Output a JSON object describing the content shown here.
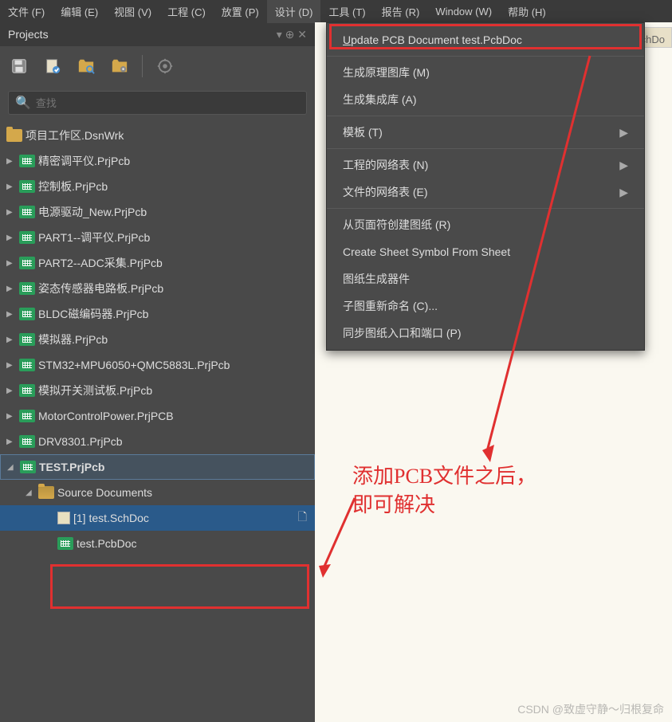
{
  "menubar": {
    "items": [
      {
        "label": "文件 (F)"
      },
      {
        "label": "编辑 (E)"
      },
      {
        "label": "视图 (V)"
      },
      {
        "label": "工程 (C)"
      },
      {
        "label": "放置 (P)"
      },
      {
        "label": "设计 (D)",
        "active": true
      },
      {
        "label": "工具 (T)"
      },
      {
        "label": "报告 (R)"
      },
      {
        "label": "Window (W)"
      },
      {
        "label": "帮助 (H)"
      }
    ]
  },
  "panel": {
    "title": "Projects",
    "pin": "▾ ⊕ ✕"
  },
  "search": {
    "placeholder": "查找"
  },
  "tree": {
    "workspace": "项目工作区.DsnWrk",
    "projects": [
      "精密调平仪.PrjPcb",
      "控制板.PrjPcb",
      "电源驱动_New.PrjPcb",
      "PART1--调平仪.PrjPcb",
      "PART2--ADC采集.PrjPcb",
      "姿态传感器电路板.PrjPcb",
      "BLDC磁编码器.PrjPcb",
      "模拟器.PrjPcb",
      "STM32+MPU6050+QMC5883L.PrjPcb",
      "模拟开关测试板.PrjPcb",
      "MotorControlPower.PrjPCB",
      "DRV8301.PrjPcb"
    ],
    "active_project": "TEST.PrjPcb",
    "source_folder": "Source Documents",
    "source_files": [
      {
        "name": "[1] test.SchDoc",
        "selected": true
      },
      {
        "name": "test.PcbDoc",
        "selected": false
      }
    ]
  },
  "dropdown": {
    "items": [
      {
        "label": "Update PCB Document test.PcbDoc",
        "u": true,
        "sep_after": true
      },
      {
        "label": "生成原理图库 (M)"
      },
      {
        "label": "生成集成库 (A)",
        "sep_after": true
      },
      {
        "label": "模板 (T)",
        "submenu": true,
        "sep_after": true
      },
      {
        "label": "工程的网络表 (N)",
        "submenu": true
      },
      {
        "label": "文件的网络表 (E)",
        "submenu": true,
        "sep_after": true
      },
      {
        "label": "从页面符创建图纸 (R)"
      },
      {
        "label": "Create Sheet Symbol From Sheet"
      },
      {
        "label": "图纸生成器件"
      },
      {
        "label": "子图重新命名 (C)..."
      },
      {
        "label": "同步图纸入口和端口 (P)"
      }
    ]
  },
  "content": {
    "tab": "图.SchDo"
  },
  "annotation": {
    "text": "添加PCB文件之后，\n即可解决"
  },
  "watermark": "CSDN @致虚守静～归根复命"
}
